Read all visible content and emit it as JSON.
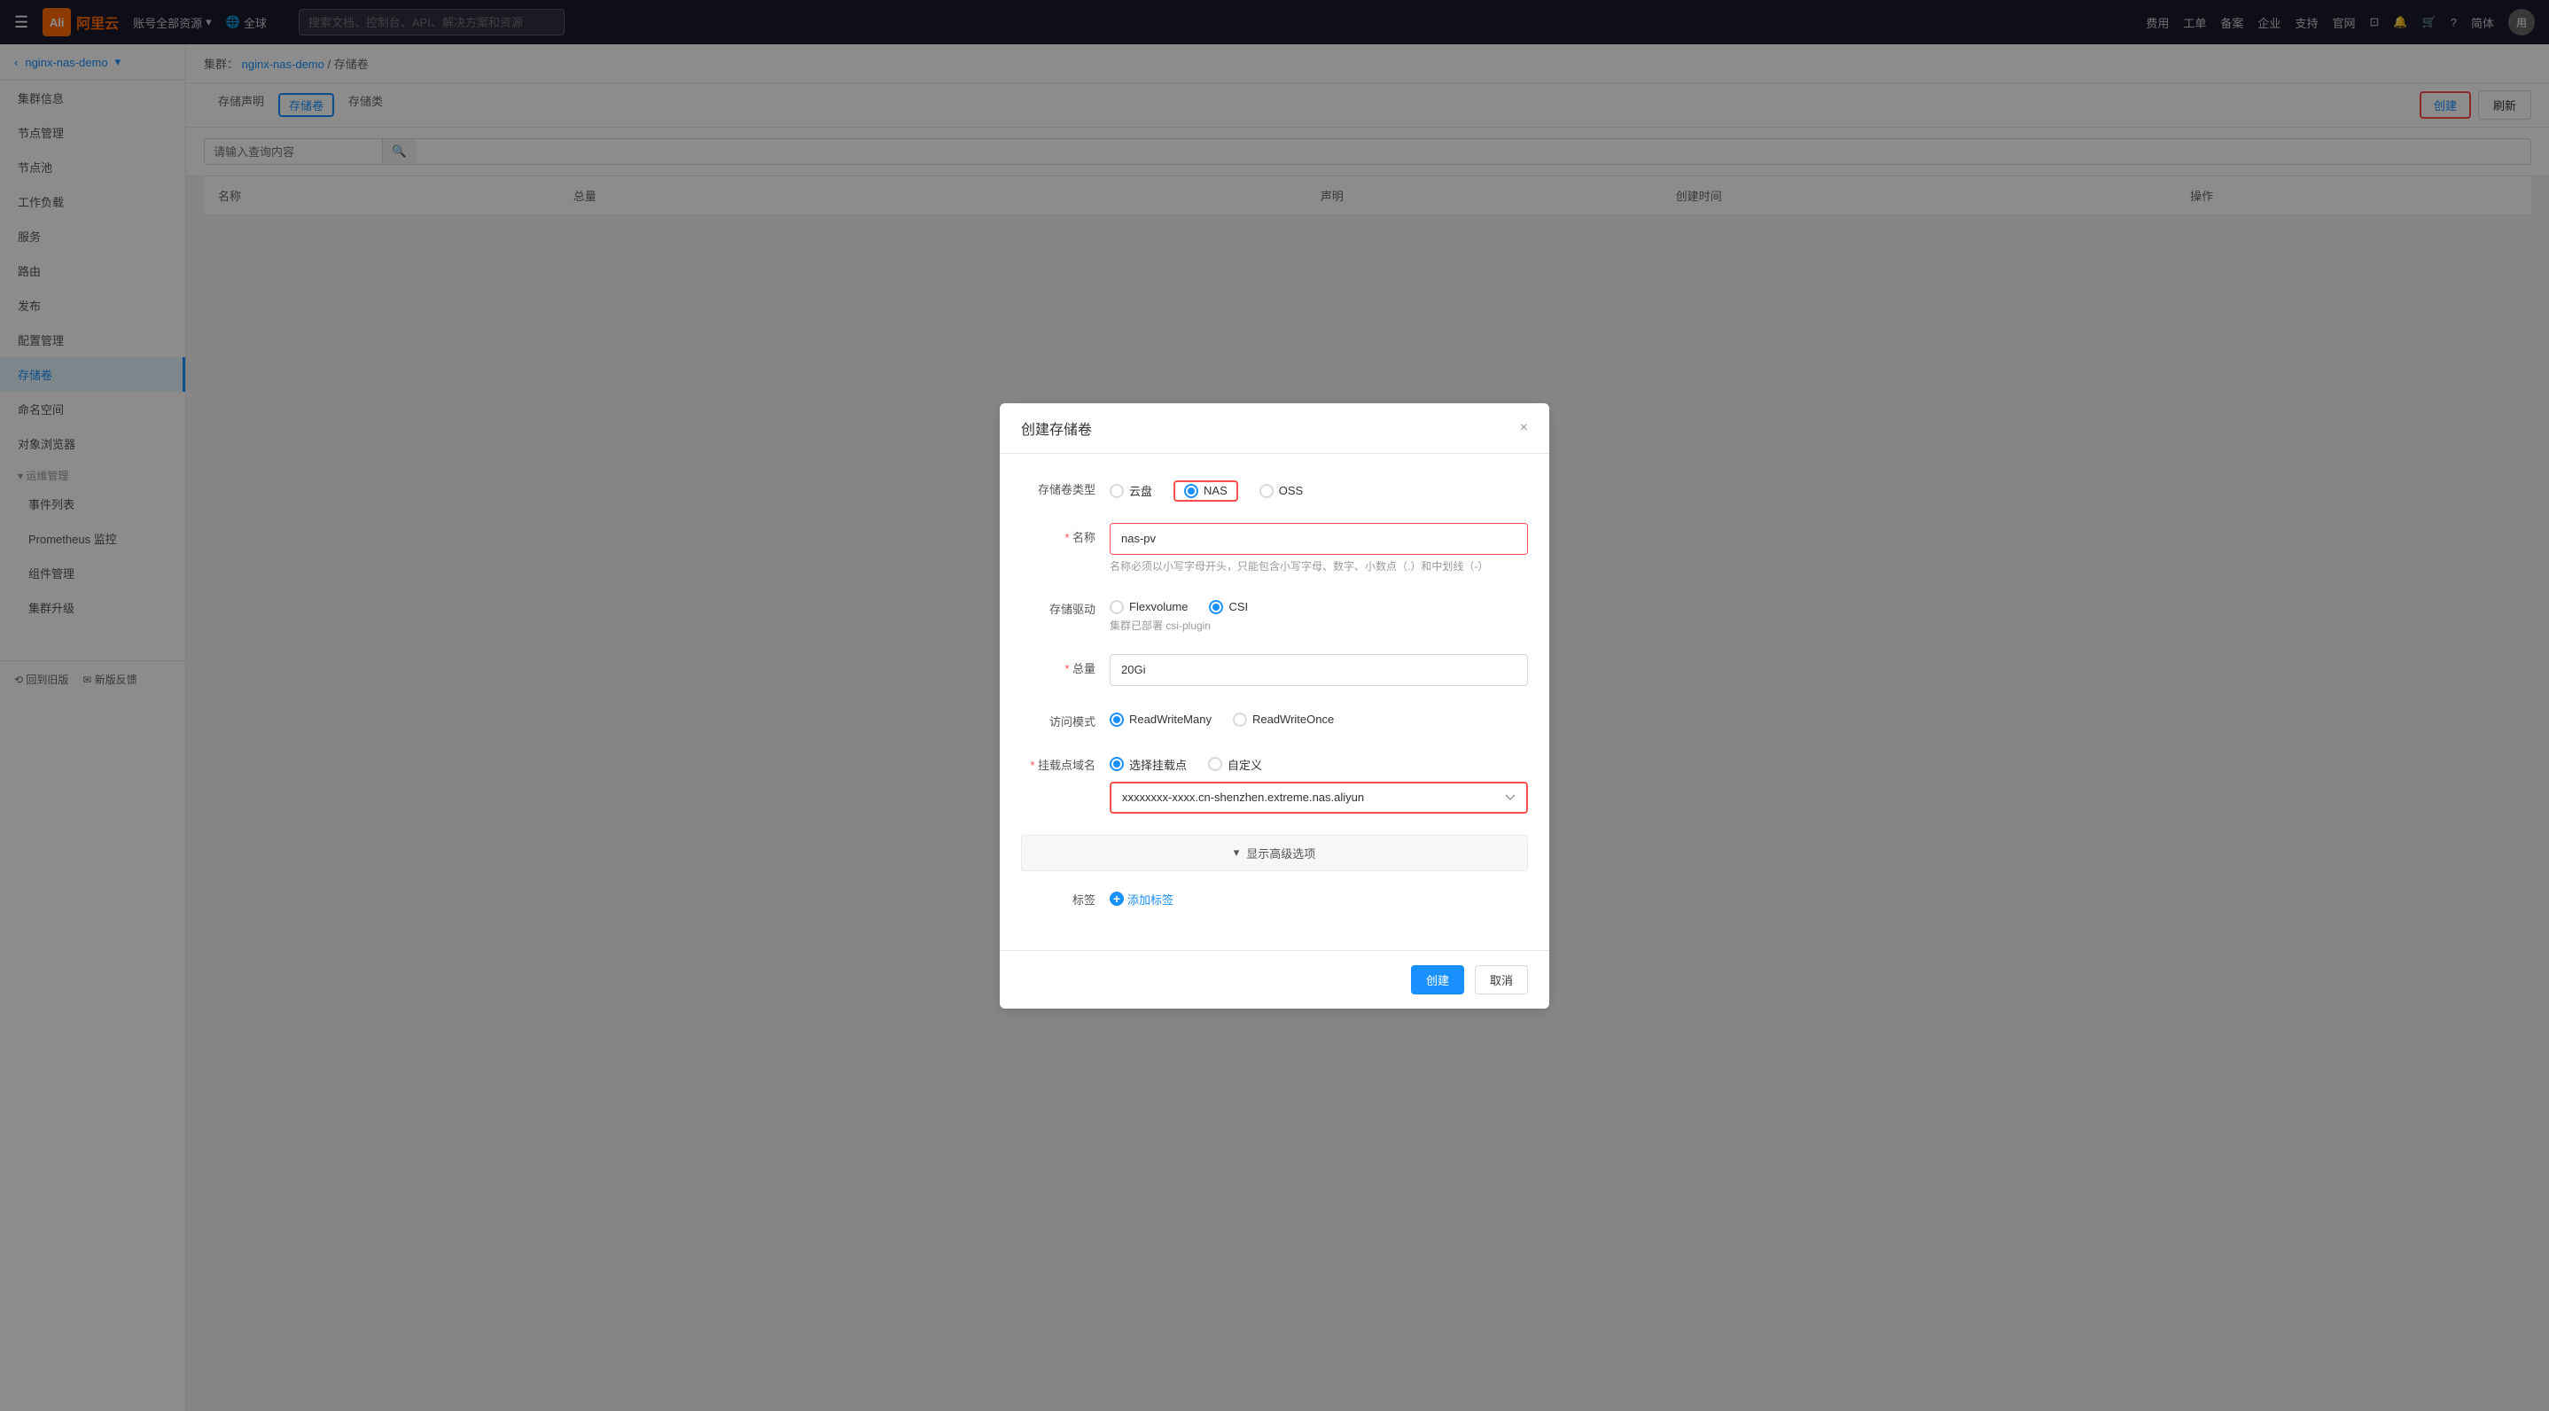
{
  "topnav": {
    "logo_text": "阿里云",
    "logo_abbr": "Ali",
    "account": "账号全部资源",
    "region": "全球",
    "search_placeholder": "搜索文档、控制台、API、解决方案和资源",
    "nav_items": [
      "费用",
      "工单",
      "备案",
      "企业",
      "支持",
      "官网"
    ],
    "lang": "简体"
  },
  "sidebar": {
    "back_label": "nginx-nas-demo",
    "items": [
      {
        "id": "cluster-info",
        "label": "集群信息"
      },
      {
        "id": "node-mgmt",
        "label": "节点管理"
      },
      {
        "id": "node-pool",
        "label": "节点池"
      },
      {
        "id": "workload",
        "label": "工作负载"
      },
      {
        "id": "service",
        "label": "服务"
      },
      {
        "id": "routing",
        "label": "路由"
      },
      {
        "id": "publish",
        "label": "发布"
      },
      {
        "id": "config-mgmt",
        "label": "配置管理"
      },
      {
        "id": "storage",
        "label": "存储卷",
        "active": true
      },
      {
        "id": "namespace",
        "label": "命名空间"
      },
      {
        "id": "object-browser",
        "label": "对象浏览器"
      },
      {
        "id": "ops-section",
        "label": "运维管理",
        "section": true
      },
      {
        "id": "event-list",
        "label": "事件列表",
        "sub": true
      },
      {
        "id": "prometheus",
        "label": "Prometheus 监控",
        "sub": true
      },
      {
        "id": "component-mgmt",
        "label": "组件管理",
        "sub": true
      },
      {
        "id": "cluster-upgrade",
        "label": "集群升级",
        "sub": true
      }
    ],
    "footer_items": [
      {
        "id": "back-old",
        "label": "回到旧版"
      },
      {
        "id": "new-feedback",
        "label": "新版反馈"
      }
    ]
  },
  "breadcrumb": {
    "cluster_label": "集群：",
    "cluster_name": "nginx-nas-demo",
    "separator": "/",
    "page": "存储卷"
  },
  "tabs": {
    "items": [
      {
        "id": "pvc",
        "label": "存储声明"
      },
      {
        "id": "pv",
        "label": "存储卷",
        "active": true,
        "bordered": true
      },
      {
        "id": "sc",
        "label": "存储类"
      }
    ]
  },
  "toolbar": {
    "search_placeholder": "请输入查询内容",
    "create_label": "创建",
    "refresh_label": "刷新"
  },
  "table": {
    "columns": [
      "名称",
      "总量",
      "",
      "",
      "声明",
      "创建时间",
      "操作"
    ]
  },
  "modal": {
    "title": "创建存储卷",
    "close_title": "×",
    "fields": {
      "type": {
        "label": "存储卷类型",
        "options": [
          {
            "id": "cloud-disk",
            "label": "云盘",
            "checked": false
          },
          {
            "id": "nas",
            "label": "NAS",
            "checked": true,
            "highlighted": true
          },
          {
            "id": "oss",
            "label": "OSS",
            "checked": false
          }
        ]
      },
      "name": {
        "label": "名称",
        "required": true,
        "value": "nas-pv",
        "hint": "名称必须以小写字母开头，只能包含小写字母、数字、小数点（.）和中划线（-）"
      },
      "driver": {
        "label": "存储驱动",
        "options": [
          {
            "id": "flexvolume",
            "label": "Flexvolume",
            "checked": false
          },
          {
            "id": "csi",
            "label": "CSI",
            "checked": true
          }
        ],
        "hint": "集群已部署 csi-plugin"
      },
      "capacity": {
        "label": "总量",
        "required": true,
        "value": "20Gi"
      },
      "access_mode": {
        "label": "访问模式",
        "options": [
          {
            "id": "rwm",
            "label": "ReadWriteMany",
            "checked": true
          },
          {
            "id": "rwo",
            "label": "ReadWriteOnce",
            "checked": false
          }
        ]
      },
      "mount_domain": {
        "label": "挂载点域名",
        "required": true,
        "options": [
          {
            "id": "select-mount",
            "label": "选择挂载点",
            "checked": true
          },
          {
            "id": "custom",
            "label": "自定义",
            "checked": false
          }
        ],
        "select_value": "cn-shenzhen.extreme.nas.aliyun",
        "select_placeholder": "xxxxxxxx-xxxx.cn-shenzhen.extreme.nas.aliyun"
      },
      "advanced": {
        "toggle_label": "显示高级选项",
        "icon": "▾"
      },
      "tags": {
        "label": "标签",
        "add_label": "添加标签"
      }
    },
    "footer": {
      "confirm_label": "创建",
      "cancel_label": "取消"
    }
  }
}
